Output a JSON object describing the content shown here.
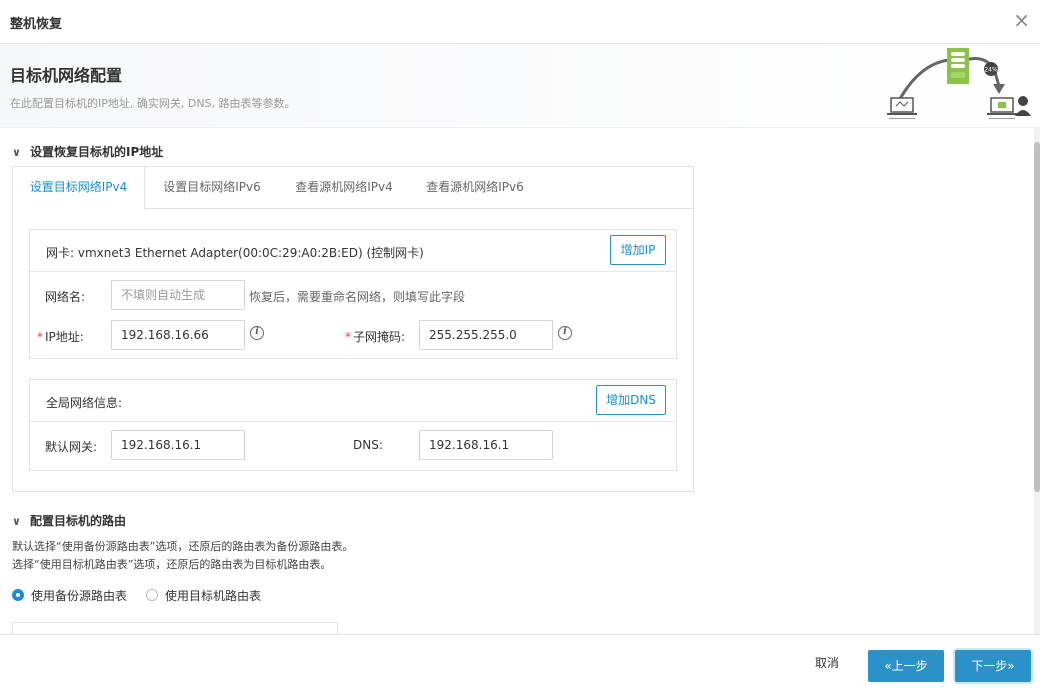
{
  "titlebar": {
    "title": "整机恢复",
    "close_glyph": "×"
  },
  "header": {
    "title": "目标机网络配置",
    "subtitle": "在此配置目标机的IP地址, 确实网关, DNS, 路由表等参数。",
    "illustration_percent": "24%"
  },
  "ip_section": {
    "title": "设置恢复目标机的IP地址",
    "tabs": [
      {
        "label": "设置目标网络IPv4",
        "active": true
      },
      {
        "label": "设置目标网络IPv6",
        "active": false
      },
      {
        "label": "查看源机网络IPv4",
        "active": false
      },
      {
        "label": "查看源机网络IPv6",
        "active": false
      }
    ],
    "nic": {
      "title": "网卡:  vmxnet3 Ethernet Adapter(00:0C:29:A0:2B:ED) (控制网卡)",
      "add_ip_label": "增加IP",
      "network_name_label": "网络名:",
      "network_name_placeholder": "不填则自动生成",
      "network_name_hint": "恢复后，需要重命名网络，则填写此字段",
      "ip_label": "IP地址:",
      "ip_value": "192.168.16.66",
      "mask_label": "子网掩码:",
      "mask_value": "255.255.255.0",
      "info_glyph": "i",
      "required_mark": "*"
    },
    "global": {
      "title": "全局网络信息:",
      "add_dns_label": "增加DNS",
      "gateway_label": "默认网关:",
      "gateway_value": "192.168.16.1",
      "dns_label": "DNS:",
      "dns_value": "192.168.16.1"
    }
  },
  "route_section": {
    "title": "配置目标机的路由",
    "desc_line1": "默认选择“使用备份源路由表”选项，还原后的路由表为备份源路由表。",
    "desc_line2": "选择“使用目标机路由表”选项，还原后的路由表为目标机路由表。",
    "option_source": "使用备份源路由表",
    "option_target": "使用目标机路由表",
    "selected": "source"
  },
  "footer": {
    "cancel_label": "取消",
    "prev_label": "«上一步",
    "next_label": "下一步»"
  },
  "colors": {
    "accent": "#1a8dcf",
    "primary_button": "#2a92c8",
    "required": "#e54545",
    "server_green": "#8bc34a"
  }
}
